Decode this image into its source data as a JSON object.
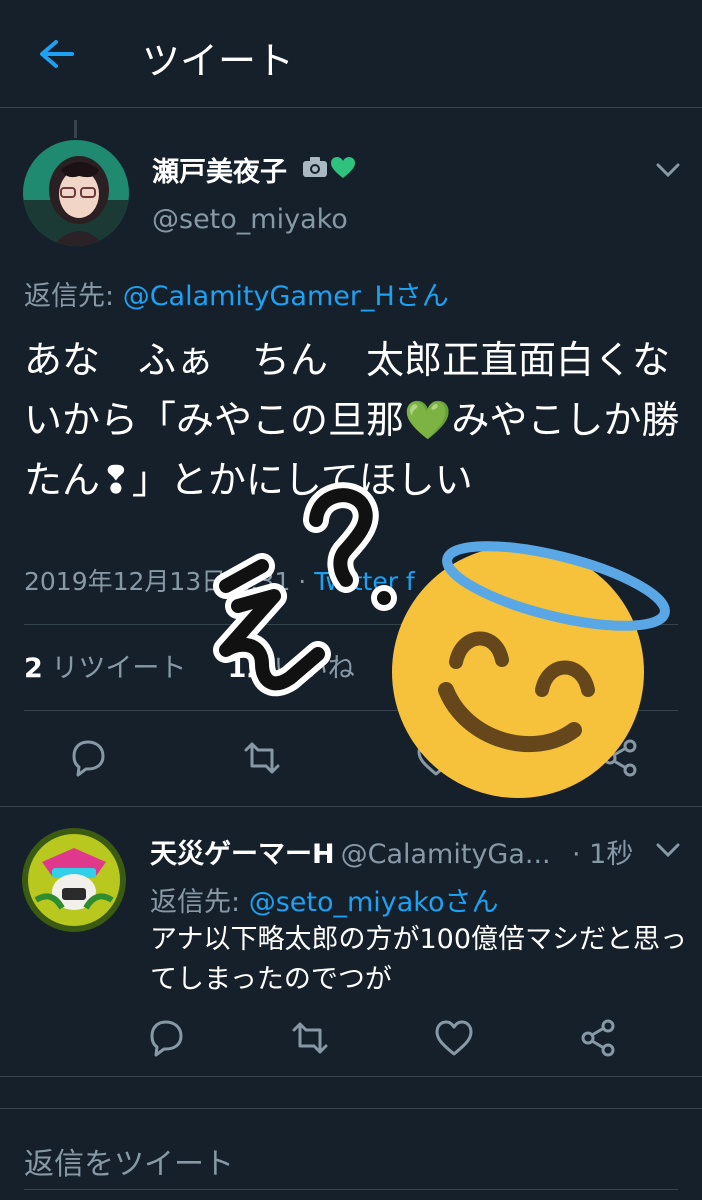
{
  "header": {
    "title": "ツイート",
    "back_icon": "arrow-left-icon"
  },
  "main_tweet": {
    "display_name": "瀬戸美夜子",
    "handle": "@seto_miyako",
    "reply_to_prefix": "返信先: ",
    "reply_to_user": "@CalamityGamer_Hさん",
    "text": "あな　ふぁ　ちん　太郎正直面白くないから「みやこの旦那💚みやこしか勝たん❢」とかにしてほしい",
    "timestamp": "2019年12月13日 ",
    "time_partial": "1:31 · ",
    "source": "Twitter f",
    "retweets_count": "2",
    "retweets_label": "リツイート",
    "likes_count": "12",
    "likes_label": "いいね"
  },
  "reply_tweet": {
    "display_name": "天災ゲーマーH",
    "handle": "@CalamityGa...",
    "time": "· 1秒",
    "reply_to_prefix": "返信先: ",
    "reply_to_user": "@seto_miyakoさん",
    "text": "アナ以下略太郎の方が100億倍マシだと思ってしまったのでつが"
  },
  "compose": {
    "placeholder": "返信をツイート"
  },
  "overlay": {
    "handwritten": "え？",
    "emoji": "smiling-face-with-halo"
  },
  "colors": {
    "background": "#15202b",
    "accent": "#1da1f2",
    "muted": "#8899a6",
    "divider": "#38444d",
    "heart_green": "#2ec27e"
  }
}
